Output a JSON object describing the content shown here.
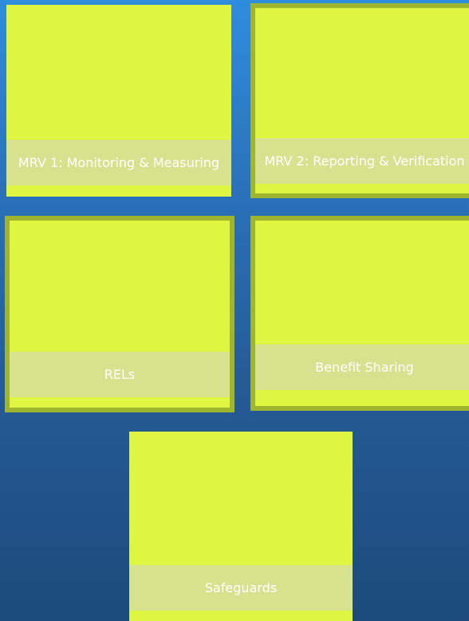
{
  "tiles": [
    {
      "label": "MRV 1: Monitoring & Measuring"
    },
    {
      "label": "MRV 2: Reporting & Verification"
    },
    {
      "label": "RELs"
    },
    {
      "label": "Benefit Sharing"
    },
    {
      "label": "Safeguards"
    }
  ],
  "colors": {
    "tile_fill": "#def542",
    "tile_border_selected": "#9fb42f",
    "label_band": "#d6e096",
    "label_text": "#ffffff",
    "background_top": "#2f8ddd",
    "background_bottom": "#1d4a7b"
  }
}
